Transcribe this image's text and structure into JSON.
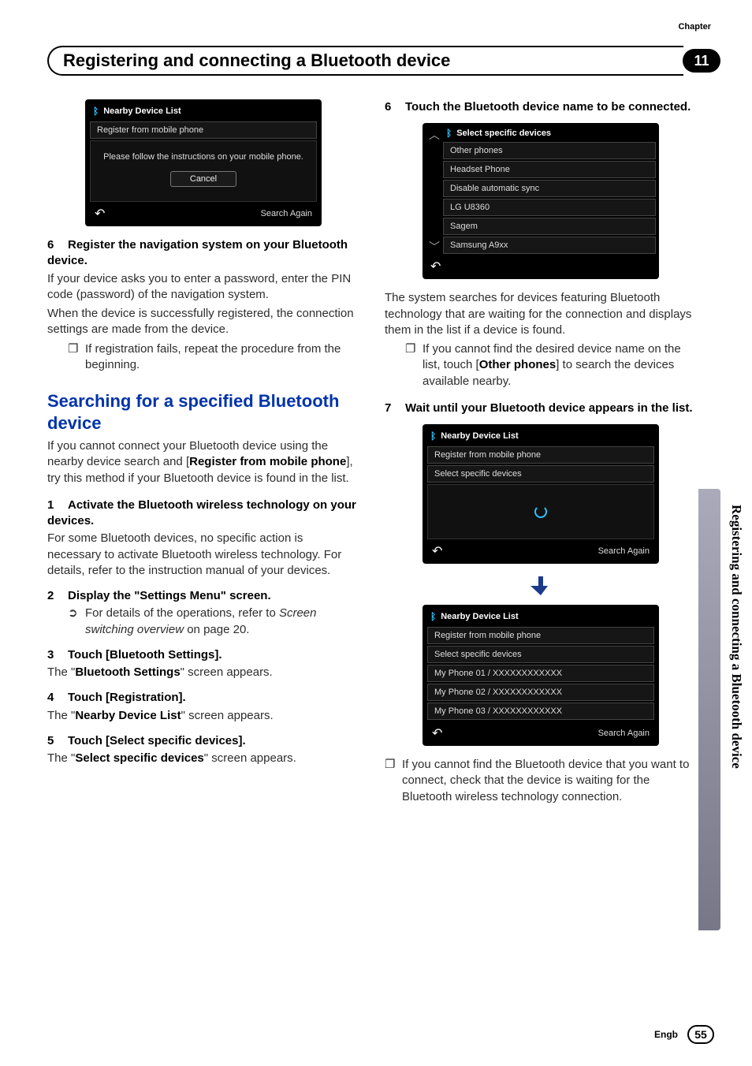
{
  "chapter_label": "Chapter",
  "chapter_number": "11",
  "header_title": "Registering and connecting a Bluetooth device",
  "side_tab": "Registering and connecting a Bluetooth device",
  "left": {
    "ss1": {
      "title": "Nearby Device List",
      "row1": "Register from mobile phone",
      "msg": "Please follow the instructions on your mobile phone.",
      "cancel": "Cancel",
      "search": "Search Again"
    },
    "s6": {
      "head_num": "6",
      "head": "Register the navigation system on your Bluetooth device.",
      "p1": "If your device asks you to enter a password, enter the PIN code (password) of the navigation system.",
      "p2": "When the device is successfully registered, the connection settings are made from the device.",
      "b1": "If registration fails, repeat the procedure from the beginning."
    },
    "section_title": "Searching for a specified Bluetooth device",
    "intro": {
      "pre": "If you cannot connect your Bluetooth device using the nearby device search and [",
      "bold": "Register from mobile phone",
      "post": "], try this method if your Bluetooth device is found in the list."
    },
    "s1": {
      "num": "1",
      "head": "Activate the Bluetooth wireless technology on your devices.",
      "p": "For some Bluetooth devices, no specific action is necessary to activate Bluetooth wireless technology. For details, refer to the instruction manual of your devices."
    },
    "s2": {
      "num": "2",
      "head": "Display the \"Settings Menu\" screen.",
      "b_pre": "For details of the operations, refer to ",
      "b_em": "Screen switching overview",
      "b_post": " on page 20."
    },
    "s3": {
      "num": "3",
      "head": "Touch [Bluetooth Settings].",
      "p_pre": "The \"",
      "p_bold": "Bluetooth Settings",
      "p_post": "\" screen appears."
    },
    "s4": {
      "num": "4",
      "head": "Touch [Registration].",
      "p_pre": "The \"",
      "p_bold": "Nearby Device List",
      "p_post": "\" screen appears."
    },
    "s5": {
      "num": "5",
      "head": "Touch [Select specific devices].",
      "p_pre": "The \"",
      "p_bold": "Select specific devices",
      "p_post": "\" screen appears."
    }
  },
  "right": {
    "s6": {
      "num": "6",
      "head": "Touch the Bluetooth device name to be connected."
    },
    "ss2": {
      "title": "Select specific devices",
      "items": [
        "Other phones",
        "Headset Phone",
        "Disable automatic sync",
        "LG U8360",
        "Sagem",
        "Samsung A9xx"
      ]
    },
    "p_after_ss2": "The system searches for devices featuring Bluetooth technology that are waiting for the connection and displays them in the list if a device is found.",
    "b_after": {
      "pre": "If you cannot find the desired device name on the list, touch [",
      "bold": "Other phones",
      "post": "] to search the devices available nearby."
    },
    "s7": {
      "num": "7",
      "head": "Wait until your Bluetooth device appears in the list."
    },
    "ss3": {
      "title": "Nearby Device List",
      "row1": "Register from mobile phone",
      "row2": "Select specific devices",
      "search": "Search Again"
    },
    "ss4": {
      "title": "Nearby Device List",
      "row1": "Register from mobile phone",
      "row2": "Select specific devices",
      "d1": "My Phone 01 / XXXXXXXXXXXX",
      "d2": "My Phone 02 / XXXXXXXXXXXX",
      "d3": "My Phone 03 / XXXXXXXXXXXX",
      "search": "Search Again"
    },
    "b_last": "If you cannot find the Bluetooth device that you want to connect, check that the device is waiting for the Bluetooth wireless technology connection."
  },
  "footer": {
    "lang": "Engb",
    "page": "55"
  }
}
